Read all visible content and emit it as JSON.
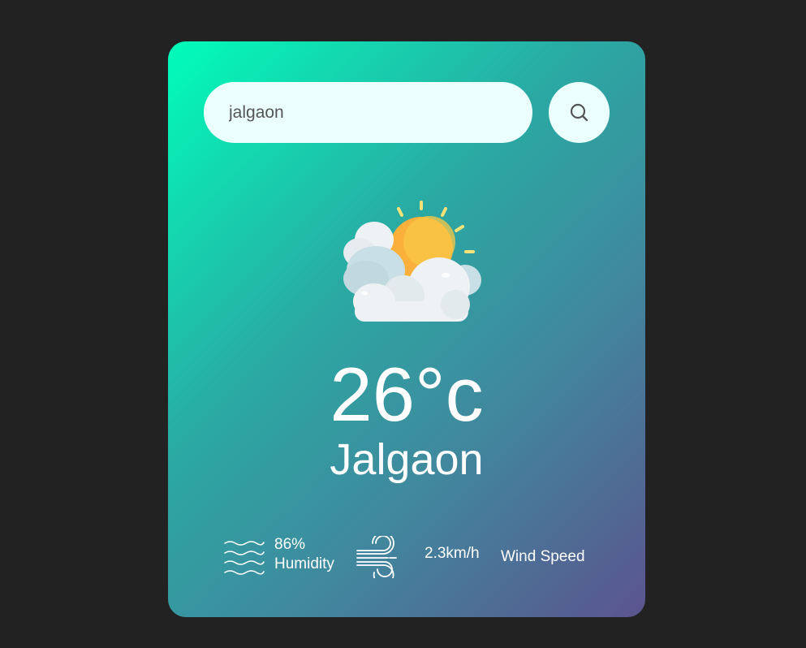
{
  "search": {
    "value": "jalgaon",
    "button_icon": "search-icon"
  },
  "weather": {
    "icon": "partly-cloudy-sun-icon",
    "temperature": "26°c",
    "city": "Jalgaon"
  },
  "details": {
    "humidity_icon": "humidity-waves-icon",
    "humidity_value": "86%",
    "humidity_label": "Humidity",
    "wind_icon": "wind-icon",
    "wind_value": "2.3km/h",
    "wind_label": "Wind Speed"
  },
  "colors": {
    "page_background": "#222222",
    "card_gradient_start": "#00feba",
    "card_gradient_end": "#5b548e",
    "input_background": "#ebfffc"
  }
}
